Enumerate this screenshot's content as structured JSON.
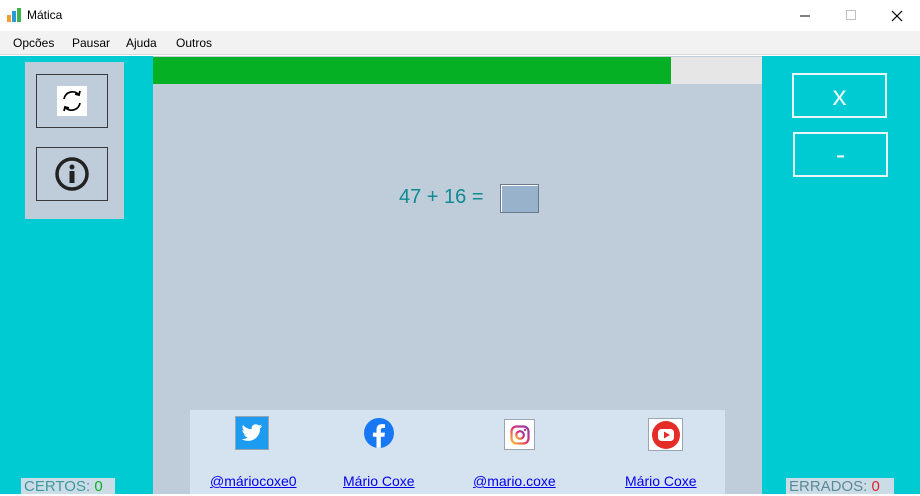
{
  "window": {
    "title": "Mática"
  },
  "menu": [
    "Opcões",
    "Pausar",
    "Ajuda",
    "Outros"
  ],
  "left_tools": [
    {
      "icon": "refresh-icon"
    },
    {
      "icon": "info-icon"
    }
  ],
  "progress": {
    "fraction": 0.85,
    "color": "#06b025"
  },
  "equation": {
    "text": "47 + 16 =",
    "answer": ""
  },
  "operations": [
    {
      "label": "x"
    },
    {
      "label": "-"
    }
  ],
  "social": [
    {
      "icon": "twitter-icon",
      "label": "@máriocoxe0"
    },
    {
      "icon": "facebook-icon",
      "label": "Mário Coxe"
    },
    {
      "icon": "instagram-icon",
      "label": "@mario.coxe"
    },
    {
      "icon": "youtube-icon",
      "label": "Mário Coxe"
    }
  ],
  "counters": {
    "correct_label": "CERTOS:",
    "correct_value": "0",
    "wrong_label": "ERRADOS:",
    "wrong_value": "0"
  },
  "colors": {
    "accent": "#00cbd2",
    "center": "#bfccd9",
    "correct": "#06b025",
    "wrong": "#e0202a"
  }
}
